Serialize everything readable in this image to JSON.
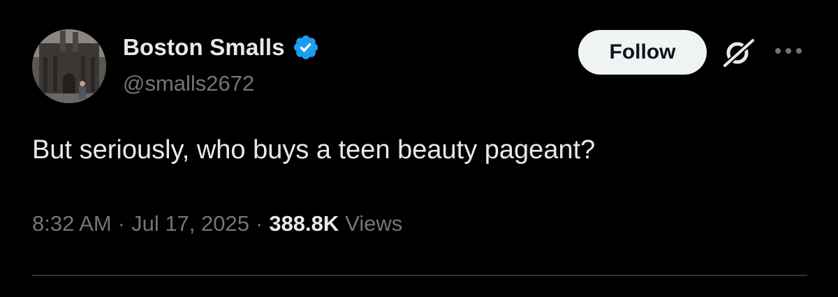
{
  "tweet": {
    "author": {
      "display_name": "Boston Smalls",
      "handle": "@smalls2672",
      "verified": true,
      "avatar_icon": "cathedral-photo-avatar"
    },
    "follow_label": "Follow",
    "text": "But seriously, who buys a teen beauty pageant?",
    "time": "8:32 AM",
    "separator": "·",
    "date": "Jul 17, 2025",
    "views_count": "388.8K",
    "views_label": "Views"
  },
  "icons": {
    "verified": "verified-badge-icon",
    "grok": "grok-icon",
    "more": "more-options-icon"
  },
  "colors": {
    "background": "#000000",
    "primary_text": "#e7e9ea",
    "secondary_text": "#71767b",
    "verified_blue": "#1d9bf0",
    "follow_button_bg": "#eff3f4",
    "divider": "#2f3336"
  }
}
